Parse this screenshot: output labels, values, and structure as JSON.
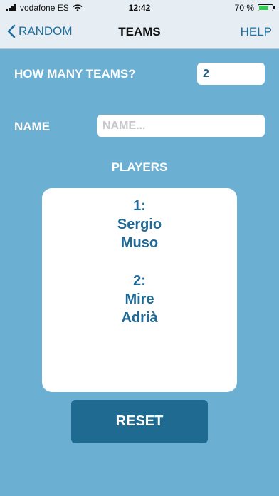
{
  "status": {
    "carrier": "vodafone ES",
    "time": "12:42",
    "battery": "70 %",
    "battery_level": 0.7
  },
  "nav": {
    "back_label": "RANDOM",
    "title": "TEAMS",
    "help_label": "HELP"
  },
  "form": {
    "teams_label": "HOW MANY TEAMS?",
    "teams_value": "2",
    "name_label": "NAME",
    "name_placeholder": "NAME...",
    "name_value": ""
  },
  "players": {
    "title": "PLAYERS",
    "teams": [
      {
        "number": "1:",
        "members": [
          "Sergio",
          "Muso"
        ]
      },
      {
        "number": "2:",
        "members": [
          "Mire",
          "Adrià"
        ]
      }
    ]
  },
  "actions": {
    "reset_label": "RESET"
  },
  "colors": {
    "background": "#6bb0d3",
    "accent": "#1f6a91",
    "nav_link": "#1f6fa1"
  }
}
